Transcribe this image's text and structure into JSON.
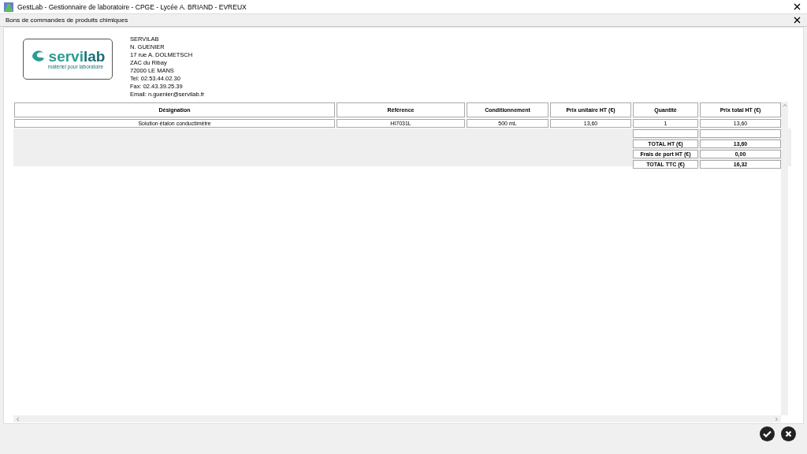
{
  "window": {
    "title": "GestLab - Gestionnaire de laboratoire - CPGE - Lycée A. BRIAND - EVREUX"
  },
  "panel": {
    "title": "Bons de commandes de produits chimiques"
  },
  "supplier": {
    "logo": {
      "name_part_1": "servi",
      "name_part_2": "lab",
      "tagline": "matériel pour laboratoire"
    },
    "address_lines": [
      "SERVILAB",
      "N. GUENIER",
      "17 rue A. DOLMETSCH",
      "ZAC du Ribay",
      "72000 LE MANS",
      "Tel: 02.53.44.02.30",
      "Fax: 02.43.39.25.39",
      "Email: n.guenier@servilab.fr"
    ]
  },
  "table": {
    "columns": [
      "Désignation",
      "Référence",
      "Conditionnement",
      "Prix unitaire HT (€)",
      "Quantité",
      "Prix total HT (€)"
    ],
    "rows": [
      [
        "Solution étalon conductimètre",
        "HI7031L",
        "500 mL",
        "13,60",
        "1",
        "13,60"
      ]
    ]
  },
  "totals": [
    {
      "label": "TOTAL HT (€)",
      "value": "13,60"
    },
    {
      "label": "Frais de port HT (€)",
      "value": "0,00"
    },
    {
      "label": "TOTAL TTC (€)",
      "value": "16,32"
    }
  ]
}
